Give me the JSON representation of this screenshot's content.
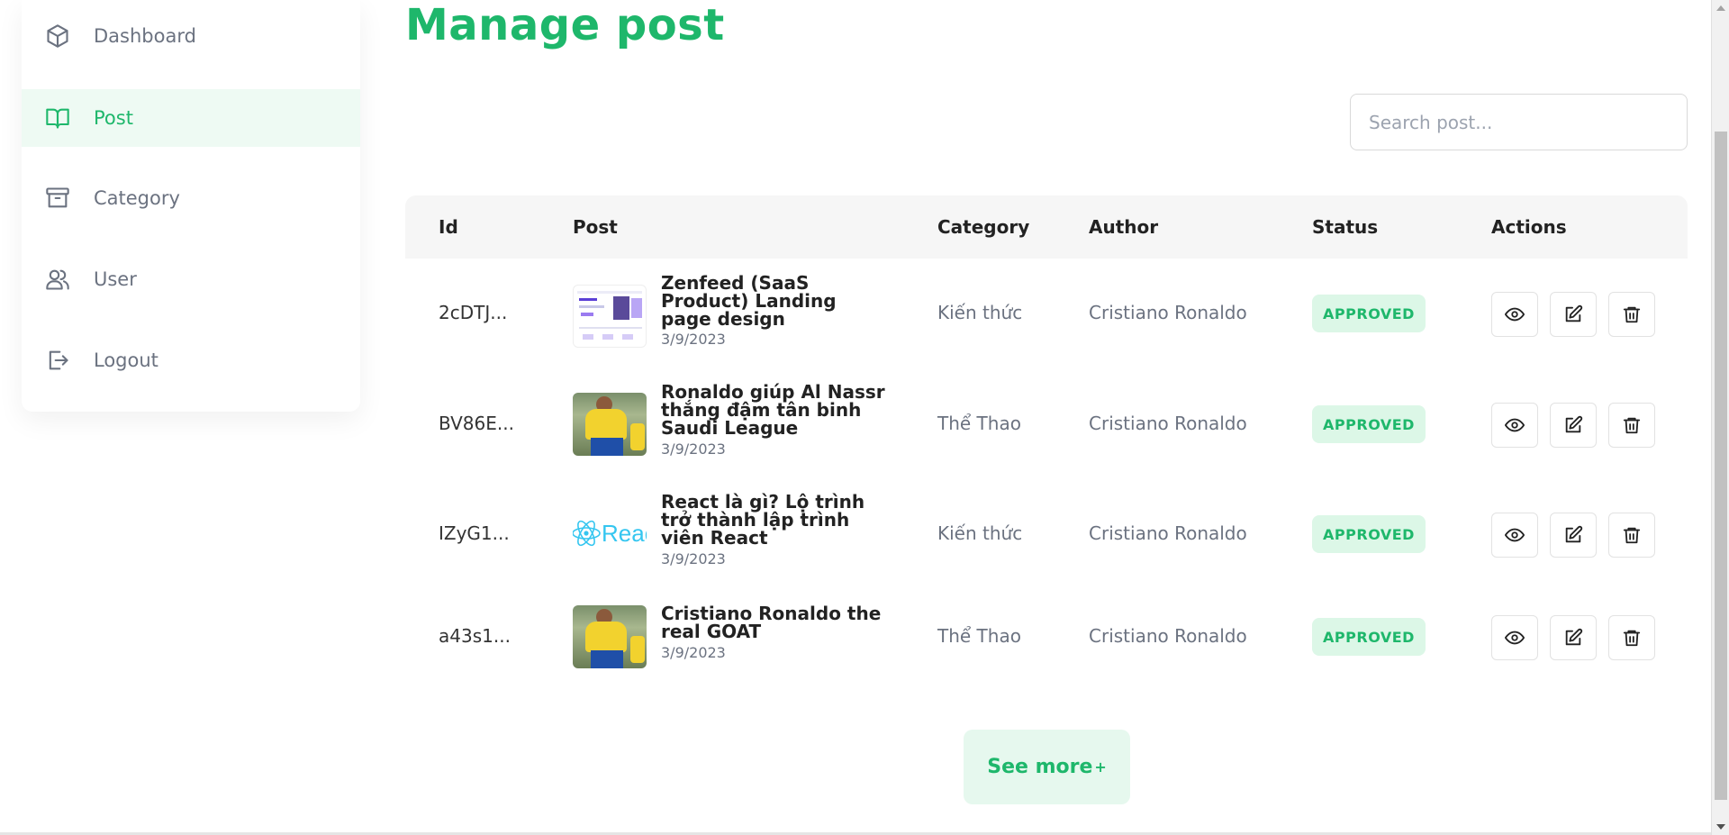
{
  "sidebar": {
    "items": [
      {
        "label": "Dashboard",
        "icon": "box-icon",
        "active": false
      },
      {
        "label": "Post",
        "icon": "book-open-icon",
        "active": true
      },
      {
        "label": "Category",
        "icon": "archive-icon",
        "active": false
      },
      {
        "label": "User",
        "icon": "users-icon",
        "active": false
      },
      {
        "label": "Logout",
        "icon": "logout-icon",
        "active": false
      }
    ]
  },
  "main": {
    "title": "Manage post",
    "search": {
      "placeholder": "Search post...",
      "value": ""
    },
    "table": {
      "headers": [
        "Id",
        "Post",
        "Category",
        "Author",
        "Status",
        "Actions"
      ],
      "rows": [
        {
          "id": "2cDTJ...",
          "title": "Zenfeed (SaaS Product) Landing page design",
          "date": "3/9/2023",
          "category": "Kiến thức",
          "author": "Cristiano Ronaldo",
          "status": "APPROVED",
          "thumbnail": "saas-landing-page"
        },
        {
          "id": "BV86E...",
          "title": "Ronaldo giúp Al Nassr thắng đậm tân binh Saudi League",
          "date": "3/9/2023",
          "category": "Thể Thao",
          "author": "Cristiano Ronaldo",
          "status": "APPROVED",
          "thumbnail": "ronaldo-photo"
        },
        {
          "id": "IZyG1...",
          "title": "React là gì? Lộ trình trở thành lập trình viên React",
          "date": "3/9/2023",
          "category": "Kiến thức",
          "author": "Cristiano Ronaldo",
          "status": "APPROVED",
          "thumbnail": "react-logo",
          "thumbnail_text": "Reac"
        },
        {
          "id": "a43s1...",
          "title": "Cristiano Ronaldo the real GOAT",
          "date": "3/9/2023",
          "category": "Thể Thao",
          "author": "Cristiano Ronaldo",
          "status": "APPROVED",
          "thumbnail": "ronaldo-photo"
        }
      ],
      "actions": [
        "view",
        "edit",
        "delete"
      ]
    },
    "see_more": {
      "label": "See more",
      "suffix": "+"
    }
  },
  "colors": {
    "accent": "#1eb76b",
    "accent_light": "#e6f8ee",
    "badge_bg": "#dcf7e7",
    "muted": "#6b7280"
  }
}
